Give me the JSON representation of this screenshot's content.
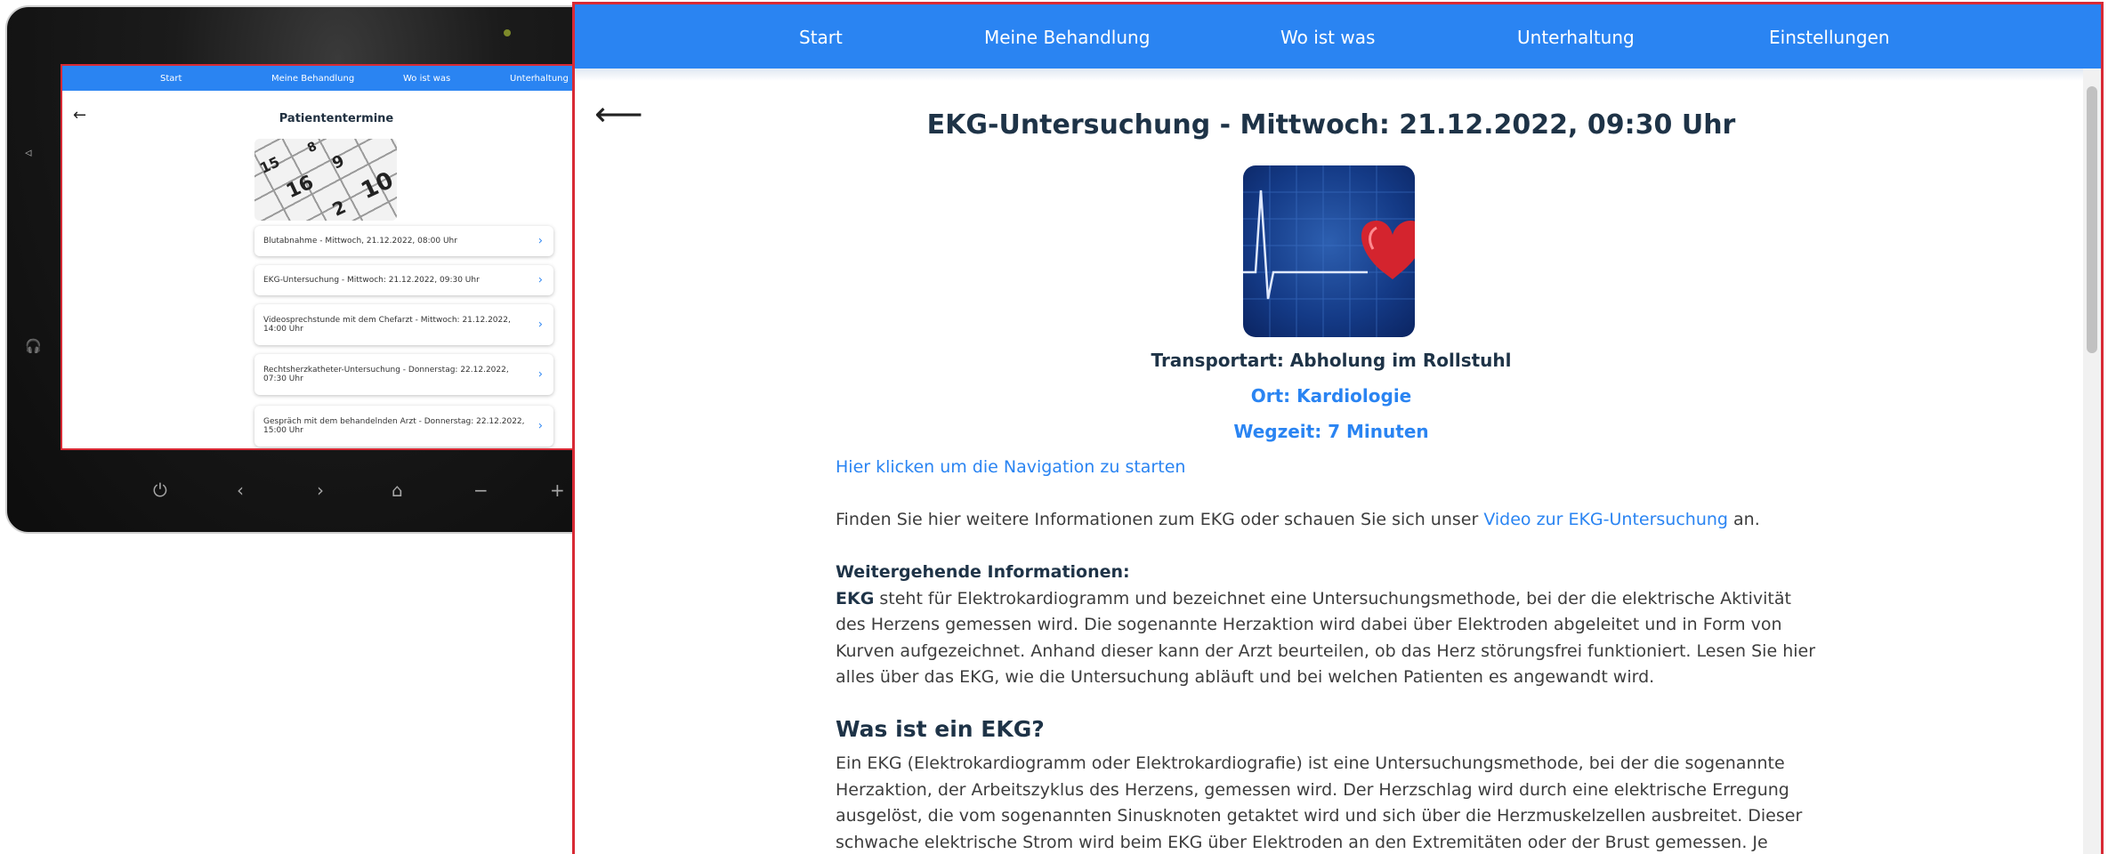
{
  "device": {
    "nav": [
      "Start",
      "Meine Behandlung",
      "Wo ist was",
      "Unterhaltung"
    ],
    "title": "Patiententermine",
    "calendar_numbers": [
      "10",
      "15",
      "16",
      "9",
      "8",
      "2"
    ],
    "appointments": [
      "Blutabnahme - Mittwoch, 21.12.2022, 08:00 Uhr",
      "EKG-Untersuchung - Mittwoch: 21.12.2022, 09:30 Uhr",
      "Videosprechstunde mit dem Chefarzt - Mittwoch: 21.12.2022, 14:00 Uhr",
      "Rechtsherzkatheter-Untersuchung - Donnerstag: 22.12.2022, 07:30 Uhr",
      "Gespräch mit dem behandelnden Arzt - Donnerstag: 22.12.2022, 15:00 Uhr"
    ]
  },
  "nav": {
    "start": "Start",
    "treatment": "Meine Behandlung",
    "where": "Wo ist was",
    "entertainment": "Unterhaltung",
    "settings": "Einstellungen"
  },
  "page": {
    "title": "EKG-Untersuchung - Mittwoch: 21.12.2022, 09:30 Uhr",
    "transport": "Transportart: Abholung im Rollstuhl",
    "location": "Ort: Kardiologie",
    "travel_time": "Wegzeit: 7 Minuten",
    "nav_link": "Hier klicken um die Navigation zu starten",
    "info_prefix": "Finden Sie hier weitere Informationen zum EKG oder schauen Sie sich unser",
    "video_link": "Video zur EKG-Untersuchung",
    "info_suffix": "an.",
    "further_heading": "Weitergehende Informationen:",
    "ekg_bold": "EKG",
    "further_text": "steht für Elektrokardiogramm und bezeichnet eine Untersuchungsmethode, bei der die elektrische Aktivität des Herzens gemessen wird. Die sogenannte Herzaktion wird dabei über Elektroden abgeleitet und in Form von Kurven aufgezeichnet. Anhand dieser kann der Arzt beurteilen, ob das Herz störungsfrei funktioniert. Lesen Sie hier alles über das EKG, wie die Untersuchung abläuft und bei welchen Patienten es angewandt wird.",
    "section_heading": "Was ist ein EKG?",
    "section_text": "Ein EKG (Elektrokardiogramm oder Elektrokardiografie) ist eine Untersuchungsmethode, bei der die sogenannte Herzaktion, der Arbeitszyklus des Herzens, gemessen wird. Der Herzschlag wird durch eine elektrische Erregung ausgelöst, die vom sogenannten Sinusknoten getaktet wird und sich über die Herzmuskelzellen ausbreitet. Dieser schwache elektrische Strom wird beim EKG über Elektroden an den Extremitäten oder der Brust gemessen. Je nachdem,"
  },
  "colors": {
    "nav": "#2a84f2",
    "frame": "#d82a35",
    "heading": "#1e3347",
    "link": "#2a84f2"
  }
}
